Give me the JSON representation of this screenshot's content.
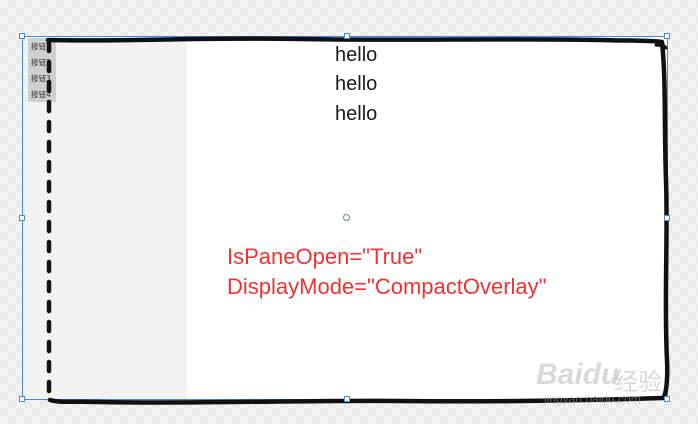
{
  "pane": {
    "buttons": [
      {
        "label": "按钮1"
      },
      {
        "label": "按钮2"
      },
      {
        "label": "按钮3"
      },
      {
        "label": "按钮4"
      }
    ]
  },
  "content": {
    "hello_lines": [
      "hello",
      "hello",
      "hello"
    ]
  },
  "annotation": {
    "line1": "IsPaneOpen=\"True\"",
    "line2": "DisplayMode=\"CompactOverlay\""
  },
  "watermark": {
    "brand": "Baidu",
    "brand_cn": "经验",
    "url": "jingyan.baidu.com"
  },
  "colors": {
    "annotation": "#ee3333",
    "selection": "#4f87d9",
    "pane_background": "#f2f2f2",
    "compact_strip": "#cfcfcf"
  }
}
